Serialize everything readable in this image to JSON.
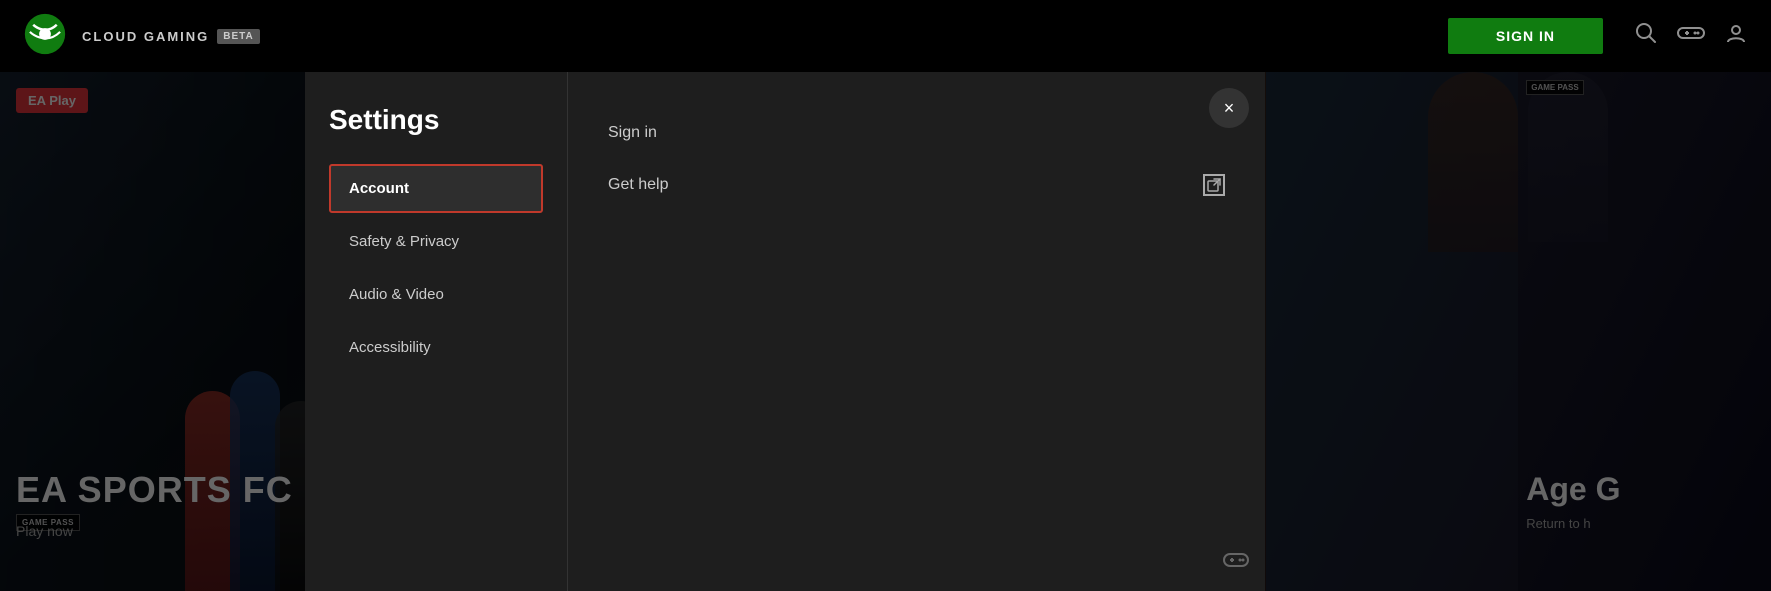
{
  "navbar": {
    "logo_alt": "Xbox",
    "cloud_gaming_label": "CLOUD GAMING",
    "beta_label": "BETA",
    "signin_button_label": "SIGN IN",
    "search_icon": "🔍",
    "controller_icon": "🎮",
    "profile_icon": "👤"
  },
  "hero": {
    "left": {
      "ea_play_label": "EA Play",
      "game_pass_label": "GAME PASS",
      "title": "EA SPORTS FC",
      "subtitle": "Play now"
    },
    "right": {
      "age_badge": "GAME PASS",
      "age_title": "Age G",
      "age_return": "Return to h"
    }
  },
  "settings": {
    "title": "Settings",
    "close_button_label": "×",
    "nav_items": [
      {
        "id": "account",
        "label": "Account",
        "active": true
      },
      {
        "id": "safety-privacy",
        "label": "Safety & Privacy",
        "active": false
      },
      {
        "id": "audio-video",
        "label": "Audio & Video",
        "active": false
      },
      {
        "id": "accessibility",
        "label": "Accessibility",
        "active": false
      }
    ],
    "content": {
      "account_items": [
        {
          "id": "sign-in",
          "label": "Sign in",
          "has_link": false
        },
        {
          "id": "get-help",
          "label": "Get help",
          "has_link": true
        }
      ]
    }
  }
}
